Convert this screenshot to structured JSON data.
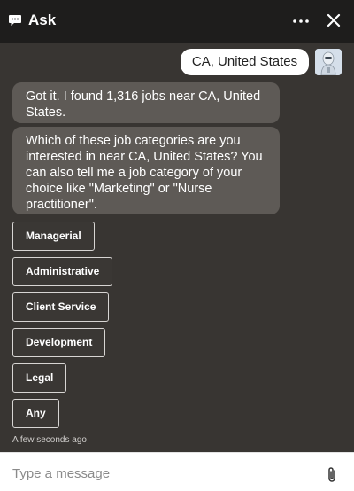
{
  "header": {
    "title": "Ask",
    "icons": {
      "chat": "chat-bubble-icon",
      "more": "more-dots-icon",
      "close": "close-icon"
    }
  },
  "conversation": {
    "user_message": "CA, United States",
    "bot_message_1": "Got it. I found 1,316 jobs near CA, United States.",
    "bot_message_2": "Which of these job categories are you interested in near CA, United States? You can also tell me a job category of your choice like \"Marketing\" or \"Nurse practitioner\".",
    "options": [
      "Managerial",
      "Administrative",
      "Client Service",
      "Development",
      "Legal",
      "Any"
    ],
    "timestamp": "A few seconds ago"
  },
  "composer": {
    "placeholder": "Type a message",
    "attach_icon": "paperclip-icon"
  },
  "colors": {
    "header_bg": "#1e1d1c",
    "chat_bg": "#383532",
    "bot_bubble": "#5e5a56",
    "user_bubble": "#ffffff"
  }
}
